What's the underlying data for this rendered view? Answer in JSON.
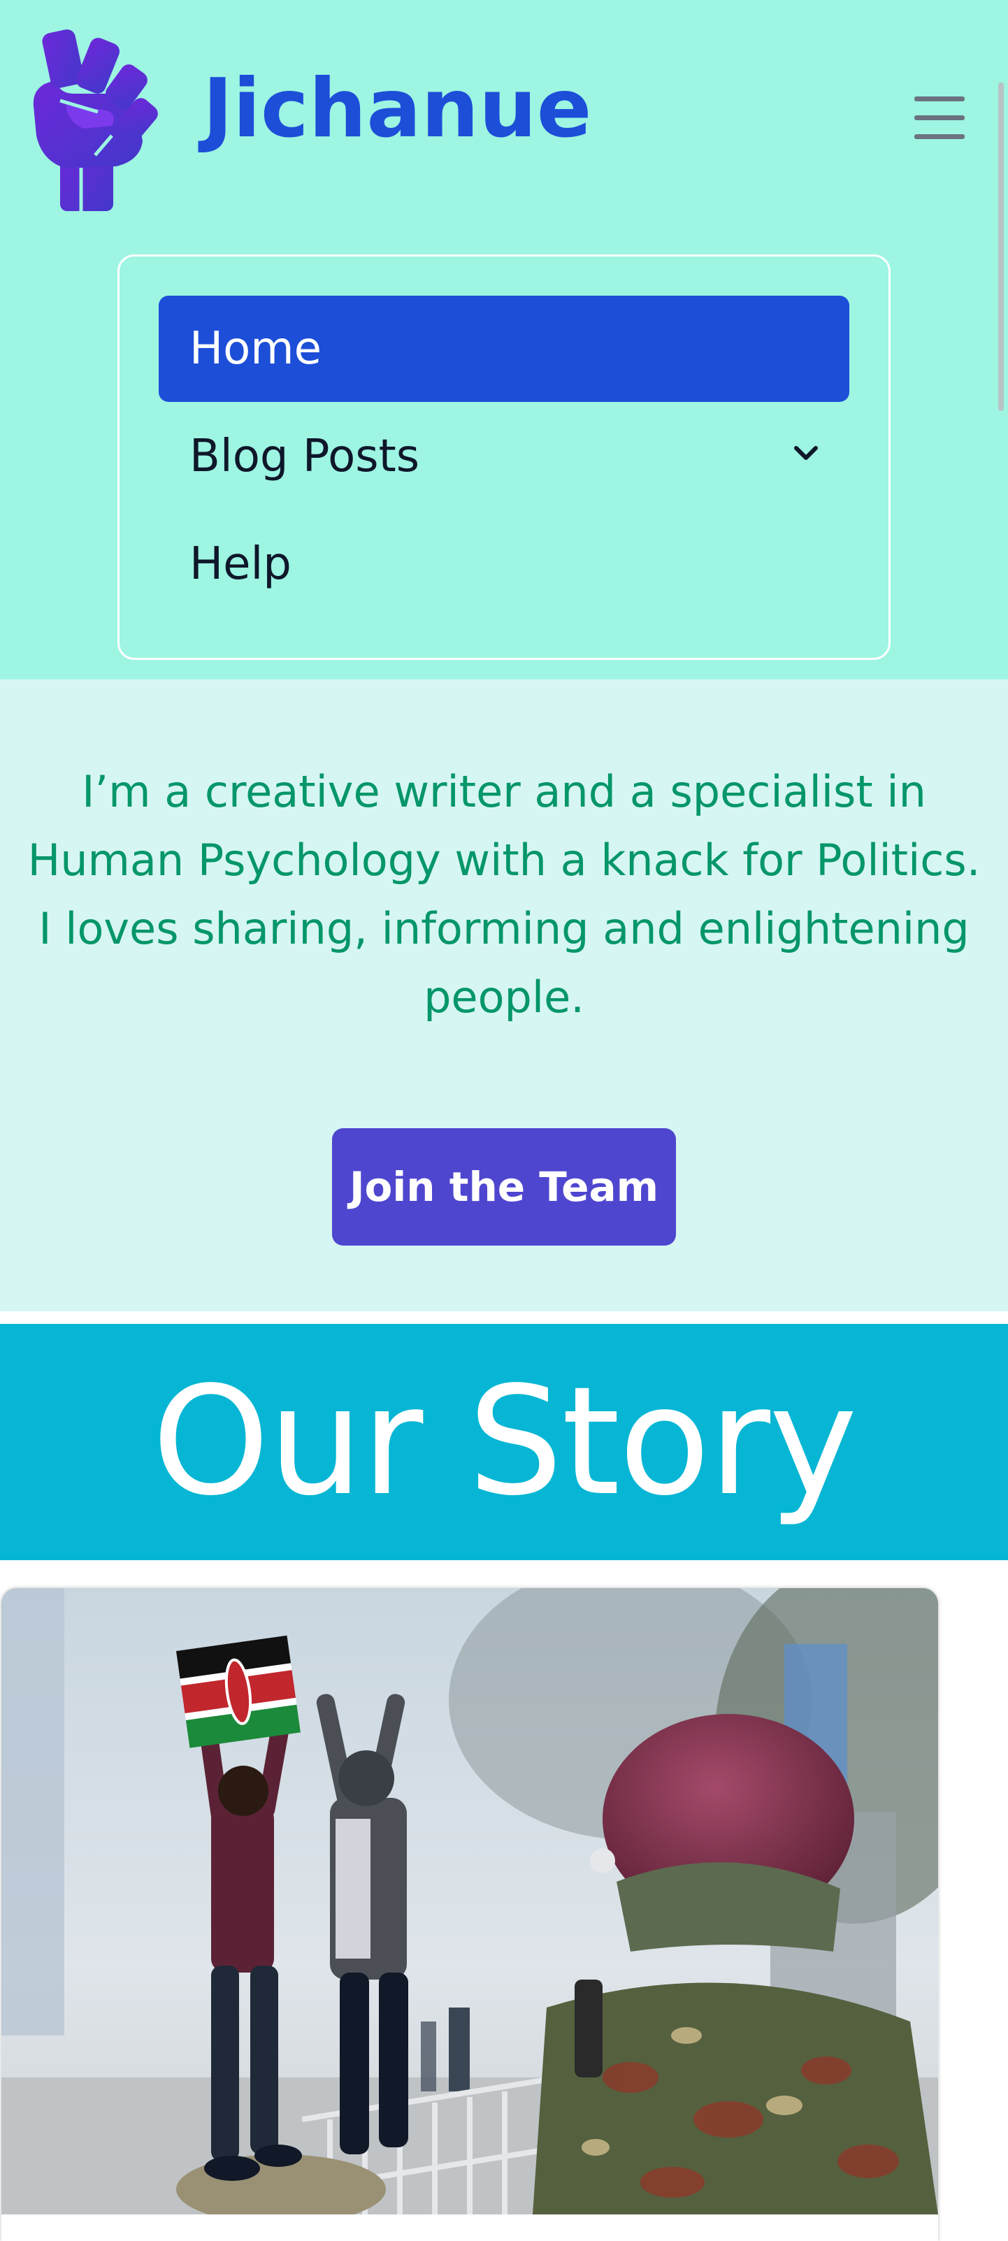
{
  "brand": {
    "name": "Jichanue",
    "logo_icon": "raised-fist-icon",
    "logo_color": "#4f46e5"
  },
  "header": {
    "menu_icon": "hamburger-menu-icon",
    "background": "#9df5e2"
  },
  "nav": {
    "items": [
      {
        "label": "Home",
        "active": true
      },
      {
        "label": "Blog Posts",
        "has_dropdown": true,
        "dropdown_icon": "chevron-down-icon"
      },
      {
        "label": "Help"
      }
    ]
  },
  "hero": {
    "text": "I’m a creative writer and a specialist in Human Psychology with a knack for Politics. I loves sharing, informing and enlightening people.",
    "button_label": "Join the Team",
    "text_color": "#059669",
    "button_color": "#4f46cf"
  },
  "story": {
    "title": "Our Story",
    "background": "#06b6d4"
  },
  "card": {
    "image": "protest-photo"
  },
  "colors": {
    "accent": "#1d4ed8"
  }
}
